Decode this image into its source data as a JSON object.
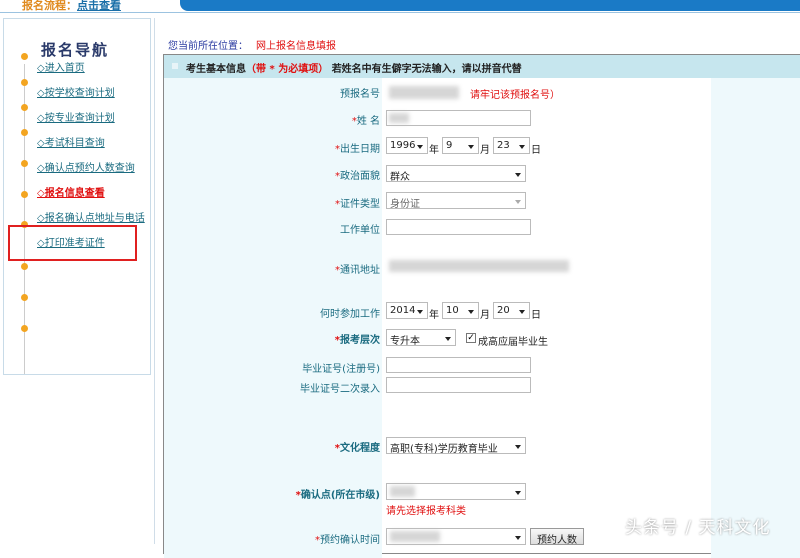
{
  "top": {
    "flow_label": "报名流程：",
    "flow_link": "点击查看"
  },
  "nav": {
    "title": "报名导航",
    "items": [
      {
        "label": "◇进入首页"
      },
      {
        "label": "◇按学校查询计划"
      },
      {
        "label": "◇按专业查询计划"
      },
      {
        "label": "◇考试科目查询"
      },
      {
        "label": "◇确认点预约人数查询"
      },
      {
        "label": "◇报名信息查看"
      },
      {
        "label": "◇报名确认点地址与电话"
      },
      {
        "label": "◇打印准考证件"
      }
    ]
  },
  "breadcrumb": {
    "label": "您当前所在位置：",
    "current": "网上报名信息填报"
  },
  "section": {
    "title": "考生基本信息",
    "required_note": "（带 * 为必填项）",
    "note": "若姓名中有生僻字无法输入，请以拼音代替"
  },
  "form": {
    "prereg": {
      "label": "预报名号",
      "hint": "请牢记该预报名号）"
    },
    "name": {
      "label": "姓 名"
    },
    "birth": {
      "label": "出生日期",
      "year": "1996",
      "month": "9",
      "day": "23",
      "y": "年",
      "m": "月",
      "d": "日"
    },
    "political": {
      "label": "政治面貌",
      "value": "群众"
    },
    "idtype": {
      "label": "证件类型",
      "value": "身份证"
    },
    "employer": {
      "label": "工作单位",
      "value": ""
    },
    "address": {
      "label": "通讯地址"
    },
    "workstart": {
      "label": "何时参加工作",
      "year": "2014",
      "month": "10",
      "day": "20"
    },
    "level": {
      "label": "报考层次",
      "value": "专升本",
      "checkbox_label": "成高应届毕业生",
      "checked": true
    },
    "diploma": {
      "label": "毕业证号(注册号)",
      "value": ""
    },
    "diploma2": {
      "label": "毕业证号二次录入",
      "value": ""
    },
    "education": {
      "label": "文化程度",
      "value": "高职(专科)学历教育毕业"
    },
    "confirm_point": {
      "label": "确认点(所在市级)",
      "hint": "请先选择报考科类"
    },
    "appointment": {
      "label": "预约确认时间",
      "button": "预约人数"
    }
  },
  "watermark": "头条号 / 天科文化"
}
